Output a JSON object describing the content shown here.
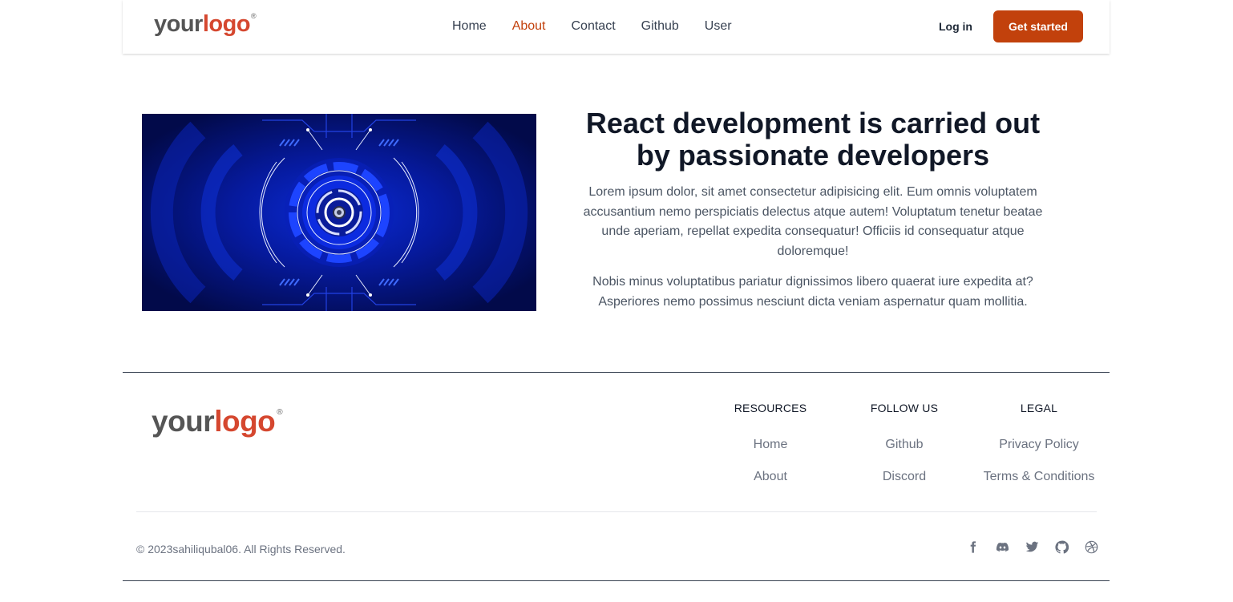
{
  "nav": {
    "logo": {
      "prefix": "your",
      "word": "logo",
      "mark": "®"
    },
    "links": [
      {
        "label": "Home",
        "active": false
      },
      {
        "label": "About",
        "active": true
      },
      {
        "label": "Contact",
        "active": false
      },
      {
        "label": "Github",
        "active": false
      },
      {
        "label": "User",
        "active": false
      }
    ],
    "login_label": "Log in",
    "cta_label": "Get started"
  },
  "hero": {
    "title": "React development is carried out by passionate developers",
    "paragraph1": "Lorem ipsum dolor, sit amet consectetur adipisicing elit. Eum omnis voluptatem accusantium nemo perspiciatis delectus atque autem! Voluptatum tenetur beatae unde aperiam, repellat expedita consequatur! Officiis id consequatur atque doloremque!",
    "paragraph2": "Nobis minus voluptatibus pariatur dignissimos libero quaerat iure expedita at? Asperiores nemo possimus nesciunt dicta veniam aspernatur quam mollitia."
  },
  "footer": {
    "logo": {
      "prefix": "your",
      "word": "logo",
      "mark": "®"
    },
    "columns": [
      {
        "heading": "RESOURCES",
        "links": [
          "Home",
          "About"
        ]
      },
      {
        "heading": "FOLLOW US",
        "links": [
          "Github",
          "Discord"
        ]
      },
      {
        "heading": "LEGAL",
        "links": [
          "Privacy Policy",
          "Terms & Conditions"
        ]
      }
    ],
    "copyright": "© 2023sahiliqubal06. All Rights Reserved.",
    "socials": [
      "facebook-icon",
      "discord-icon",
      "twitter-icon",
      "github-icon",
      "dribbble-icon"
    ]
  },
  "colors": {
    "accent": "#c2410c",
    "logo_red": "#d5472f",
    "hero_bg": "#020b55"
  }
}
